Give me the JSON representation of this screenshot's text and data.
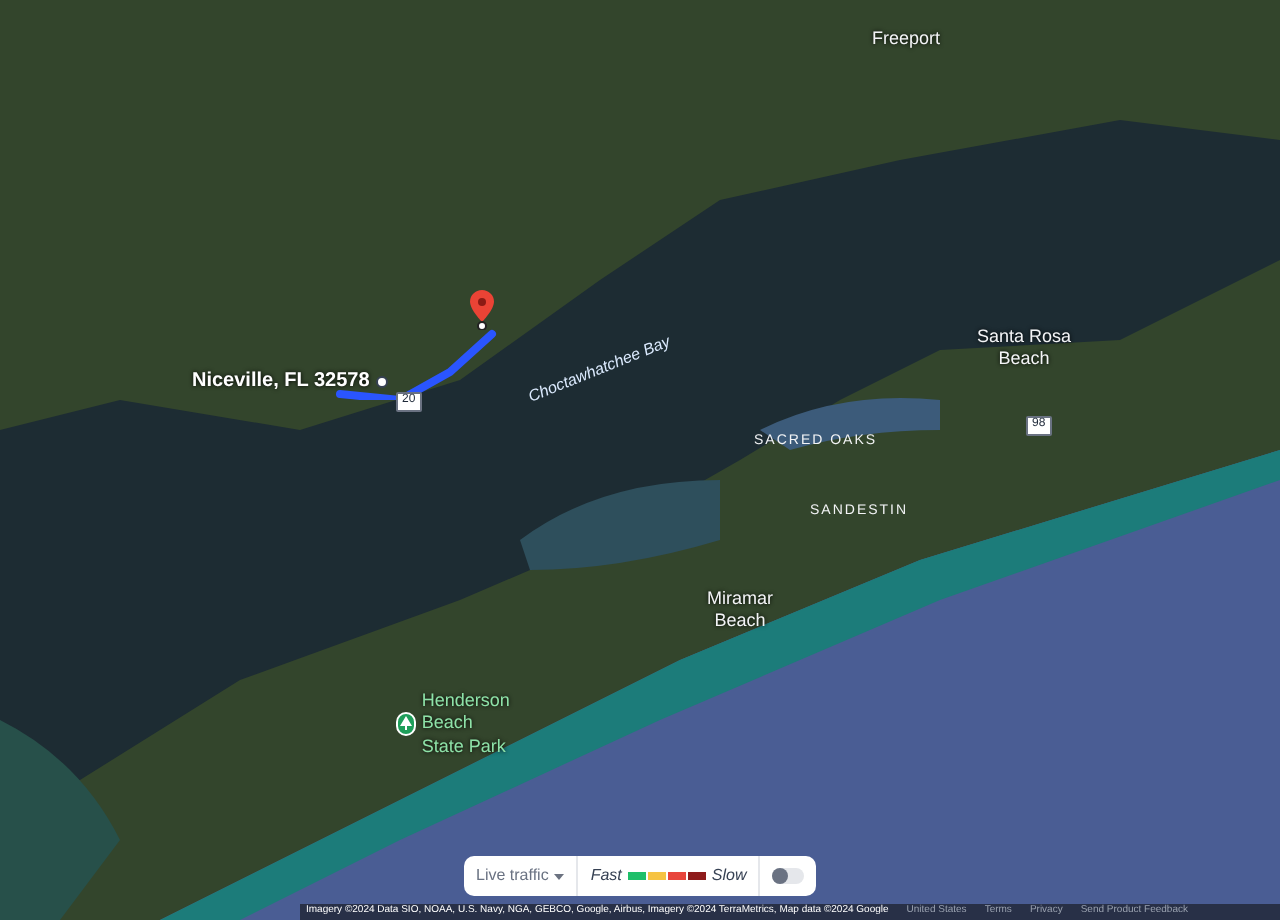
{
  "map": {
    "labels": [
      {
        "kind": "town",
        "text": "Freeport"
      },
      {
        "kind": "place",
        "text": "Niceville, FL 32578"
      },
      {
        "kind": "water",
        "text": "Choctawhatchee Bay"
      },
      {
        "kind": "town",
        "text": "Santa Rosa Beach"
      },
      {
        "kind": "area",
        "text": "SACRED OAKS"
      },
      {
        "kind": "area",
        "text": "SANDESTIN"
      },
      {
        "kind": "town",
        "text": "Miramar Beach"
      },
      {
        "kind": "park",
        "text": "Henderson Beach State Park"
      },
      {
        "kind": "shield",
        "text": "20"
      },
      {
        "kind": "shield",
        "text": "98"
      }
    ]
  },
  "traffic": {
    "dropdown": "Live traffic",
    "disabled": true,
    "fast": "Fast",
    "slow": "Slow",
    "scale": [
      {
        "color": "#1fbf6a"
      },
      {
        "color": "#f6c343"
      },
      {
        "color": "#e8453c"
      },
      {
        "color": "#8e1b1b"
      }
    ],
    "on": false
  },
  "attribution": {
    "text": "Imagery ©2024 Data SIO, NOAA, U.S. Navy, NGA, GEBCO, Google, Airbus, Imagery ©2024 TerraMetrics, Map data ©2024 Google",
    "links": [
      "United States",
      "Terms",
      "Privacy",
      "Send Product Feedback"
    ]
  }
}
